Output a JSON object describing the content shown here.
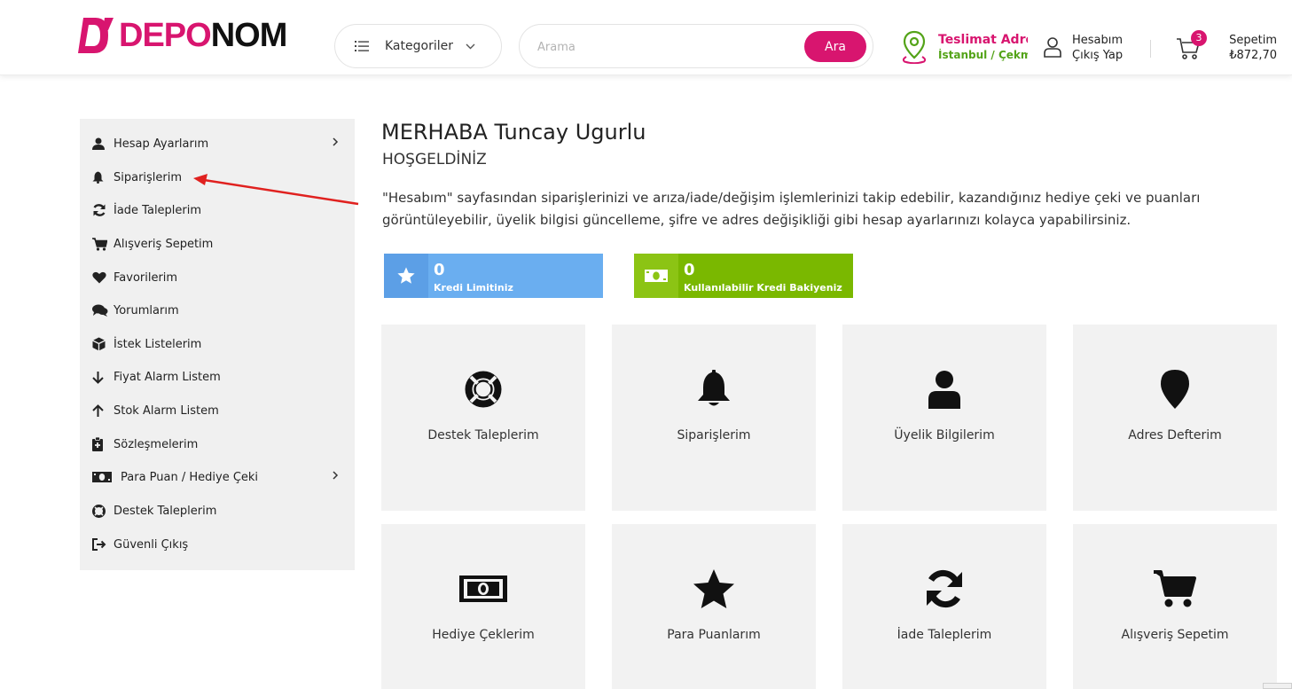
{
  "brand": {
    "part1": "DEPO",
    "part2": "NOM",
    "primary_color": "#d8156f",
    "dark_color": "#111111"
  },
  "header": {
    "categories_label": "Kategoriler",
    "search_placeholder": "Arama",
    "search_button": "Ara",
    "delivery_title": "Teslimat Adresi",
    "delivery_sub": "İstanbul / Çekmeköy",
    "account_line1": "Hesabım",
    "account_line2": "Çıkış Yap",
    "cart_count": "3",
    "cart_label": "Sepetim",
    "cart_total": "₺872,70"
  },
  "sidebar": {
    "items": [
      {
        "label": "Hesap Ayarlarım",
        "icon": "user-icon",
        "has_arrow": true
      },
      {
        "label": "Siparişlerim",
        "icon": "bell-icon",
        "has_arrow": false
      },
      {
        "label": "İade Taleplerim",
        "icon": "refresh-icon",
        "has_arrow": false
      },
      {
        "label": "Alışveriş Sepetim",
        "icon": "cart-icon",
        "has_arrow": false
      },
      {
        "label": "Favorilerim",
        "icon": "heart-icon",
        "has_arrow": false
      },
      {
        "label": "Yorumlarım",
        "icon": "comments-icon",
        "has_arrow": false
      },
      {
        "label": "İstek Listelerim",
        "icon": "box-icon",
        "has_arrow": false
      },
      {
        "label": "Fiyat Alarm Listem",
        "icon": "arrow-down-icon",
        "has_arrow": false
      },
      {
        "label": "Stok Alarm Listem",
        "icon": "arrow-up-icon",
        "has_arrow": false
      },
      {
        "label": "Sözleşmelerim",
        "icon": "clipboard-icon",
        "has_arrow": false
      },
      {
        "label": "Para Puan / Hediye Çeki",
        "icon": "money-icon",
        "has_arrow": true
      },
      {
        "label": "Destek Taleplerim",
        "icon": "lifering-icon",
        "has_arrow": false
      },
      {
        "label": "Güvenli Çıkış",
        "icon": "logout-icon",
        "has_arrow": false
      }
    ]
  },
  "main": {
    "greeting": "MERHABA Tuncay Ugurlu",
    "welcome": "HOŞGELDİNİZ",
    "intro": "\"Hesabım\" sayfasından siparişlerinizi ve arıza/iade/değişim işlemlerinizi takip edebilir, kazandığınız hediye çeki ve puanları görüntüleyebilir, üyelik bilgisi güncelleme, şifre ve adres değişikliği gibi hesap ayarlarınızı kolayca yapabilirsiniz.",
    "stats": [
      {
        "value": "0",
        "label": "Kredi Limitiniz",
        "color": "#6aaef0"
      },
      {
        "value": "0",
        "label": "Kullanılabilir Kredi Bakiyeniz",
        "color": "#7ab800"
      }
    ],
    "cards": [
      {
        "label": "Destek Taleplerim",
        "icon": "lifering-icon"
      },
      {
        "label": "Siparişlerim",
        "icon": "bell-icon"
      },
      {
        "label": "Üyelik Bilgilerim",
        "icon": "user-icon"
      },
      {
        "label": "Adres Defterim",
        "icon": "map-pin-icon"
      },
      {
        "label": "Hediye Çeklerim",
        "icon": "money-icon"
      },
      {
        "label": "Para Puanlarım",
        "icon": "star-icon"
      },
      {
        "label": "İade Taleplerim",
        "icon": "refresh-icon"
      },
      {
        "label": "Alışveriş Sepetim",
        "icon": "cart-icon"
      }
    ]
  },
  "annotation": {
    "color": "#e0211f"
  }
}
